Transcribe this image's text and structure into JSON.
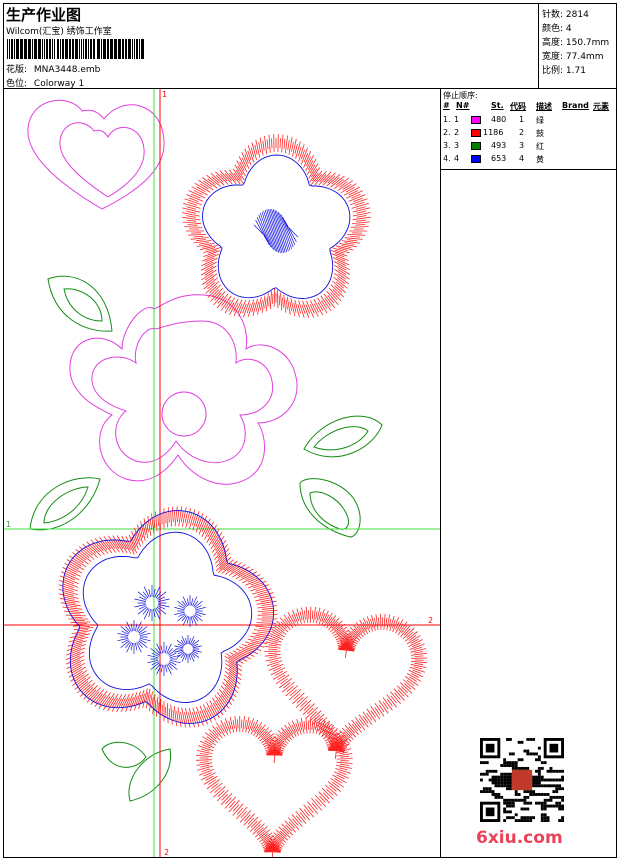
{
  "header": {
    "title": "生产作业图",
    "company": "Wilcom(汇宝) 绣饰工作室",
    "file_label": "花版:",
    "file_value": "MNA3448.emb",
    "colorway_label": "色位:",
    "colorway_value": "Colorway 1"
  },
  "stats": {
    "stitches": "针数: 2814",
    "colors": "颜色: 4",
    "height": "高度: 150.7mm",
    "width": "宽度: 77.4mm",
    "ratio": "比例: 1.71"
  },
  "stop_sequence": {
    "title": "停止顺序:",
    "columns": [
      "#",
      "N#",
      "St.",
      "代码",
      "描述",
      "Brand",
      "元素"
    ],
    "rows": [
      {
        "num": "1.",
        "n": "1",
        "color": "#ff00ff",
        "st": "480",
        "code": "1",
        "desc": "绿"
      },
      {
        "num": "2.",
        "n": "2",
        "color": "#ff0000",
        "st": "1186",
        "code": "2",
        "desc": "鼓"
      },
      {
        "num": "3.",
        "n": "3",
        "color": "#008000",
        "st": "493",
        "code": "3",
        "desc": "红"
      },
      {
        "num": "4.",
        "n": "4",
        "color": "#0000ff",
        "st": "653",
        "code": "4",
        "desc": "黄"
      }
    ]
  },
  "canvas": {
    "guide1_label": "1",
    "guide2_label": "2"
  },
  "watermark": "6xiu.com",
  "colors": {
    "magenta": "#e040e0",
    "red": "#ff2020",
    "green": "#148c14",
    "blue": "#1010e0",
    "guide_green": "#40e040",
    "guide_red": "#ff0000"
  }
}
